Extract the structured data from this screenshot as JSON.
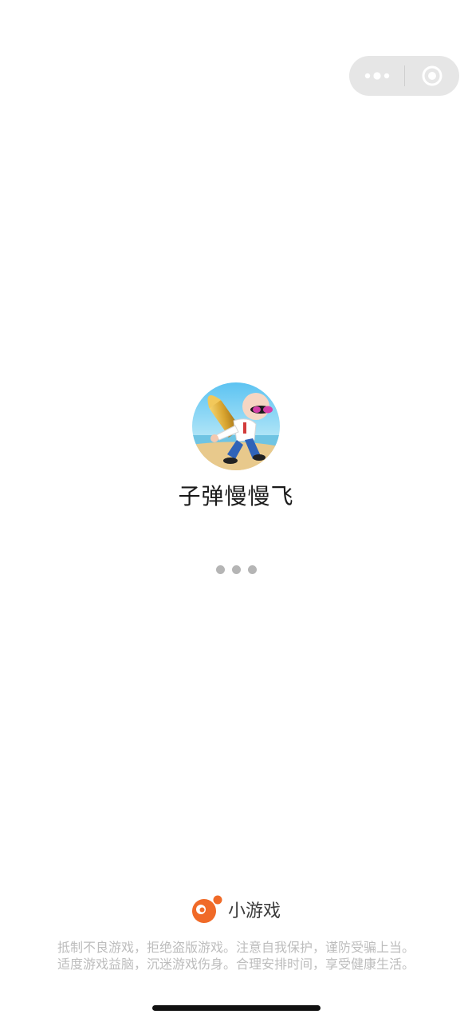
{
  "app": {
    "name": "子弹慢慢飞",
    "icon": "game-character-with-bullet-icon"
  },
  "capsule": {
    "more_icon": "more-dots-icon",
    "close_icon": "target-circle-icon"
  },
  "loading": {
    "dots": 3,
    "color": "#b5b5b5"
  },
  "brand": {
    "label": "小游戏",
    "icon": "mini-game-logo-icon",
    "color": "#f06a28"
  },
  "notice": {
    "line1": "抵制不良游戏，拒绝盗版游戏。注意自我保护，谨防受骗上当。",
    "line2": "适度游戏益脑，沉迷游戏伤身。合理安排时间，享受健康生活。"
  }
}
